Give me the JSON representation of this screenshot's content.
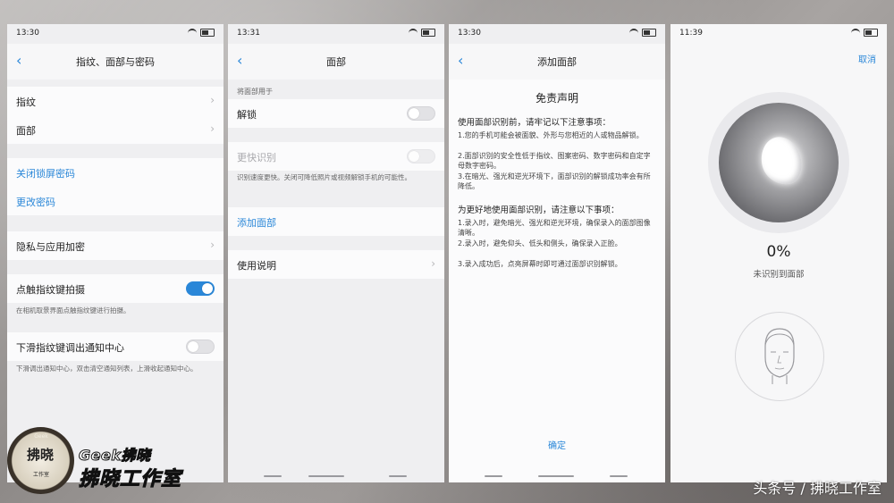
{
  "screen1": {
    "time": "13:30",
    "title": "指纹、面部与密码",
    "items": [
      "指纹",
      "面部"
    ],
    "links": [
      "关闭锁屏密码",
      "更改密码"
    ],
    "privacy": "隐私与应用加密",
    "toggle1_label": "点触指纹键拍摄",
    "toggle1_note": "在相机取景界面点触指纹键进行拍摄。",
    "toggle2_label": "下滑指纹键调出通知中心",
    "toggle2_note": "下滑调出通知中心，双击清空通知列表，上滑收起通知中心。"
  },
  "screen2": {
    "time": "13:31",
    "title": "面部",
    "section_header": "将面部用于",
    "unlock": "解锁",
    "faster": "更快识别",
    "faster_note": "识别速度更快。关闭可降低照片或视频解锁手机的可能性。",
    "add_face": "添加面部",
    "instructions": "使用说明"
  },
  "screen3": {
    "time": "13:30",
    "title": "添加面部",
    "heading": "免责声明",
    "sub1": "使用面部识别前，请牢记以下注意事项：",
    "p1": "1.您的手机可能会被面貌、外形与您相近的人或物品解锁。",
    "p2": "2.面部识别的安全性低于指纹、图案密码、数字密码和自定字母数字密码。",
    "p3": "3.在暗光、强光和逆光环境下，面部识别的解锁成功率会有所降低。",
    "sub2": "为更好地使用面部识别，请注意以下事项：",
    "q1": "1.录入时，避免暗光、强光和逆光环境，确保录入的面部图像清晰。",
    "q2": "2.录入时，避免仰头、低头和侧头，确保录入正脸。",
    "q3": "3.录入成功后，点亮屏幕时即可通过面部识别解锁。",
    "confirm": "确定"
  },
  "screen4": {
    "time": "11:39",
    "cancel": "取消",
    "progress": "0%",
    "status": "未识别到面部"
  },
  "branding": {
    "logo_char": "拂晓",
    "logo_small": "工作室",
    "logo_top": "Geek",
    "line1": "Geek拂晓",
    "line2": "拂晓工作室",
    "watermark": "头条号 / 拂晓工作室"
  },
  "colors": {
    "accent": "#2a87d8",
    "background": "#efeff1"
  }
}
